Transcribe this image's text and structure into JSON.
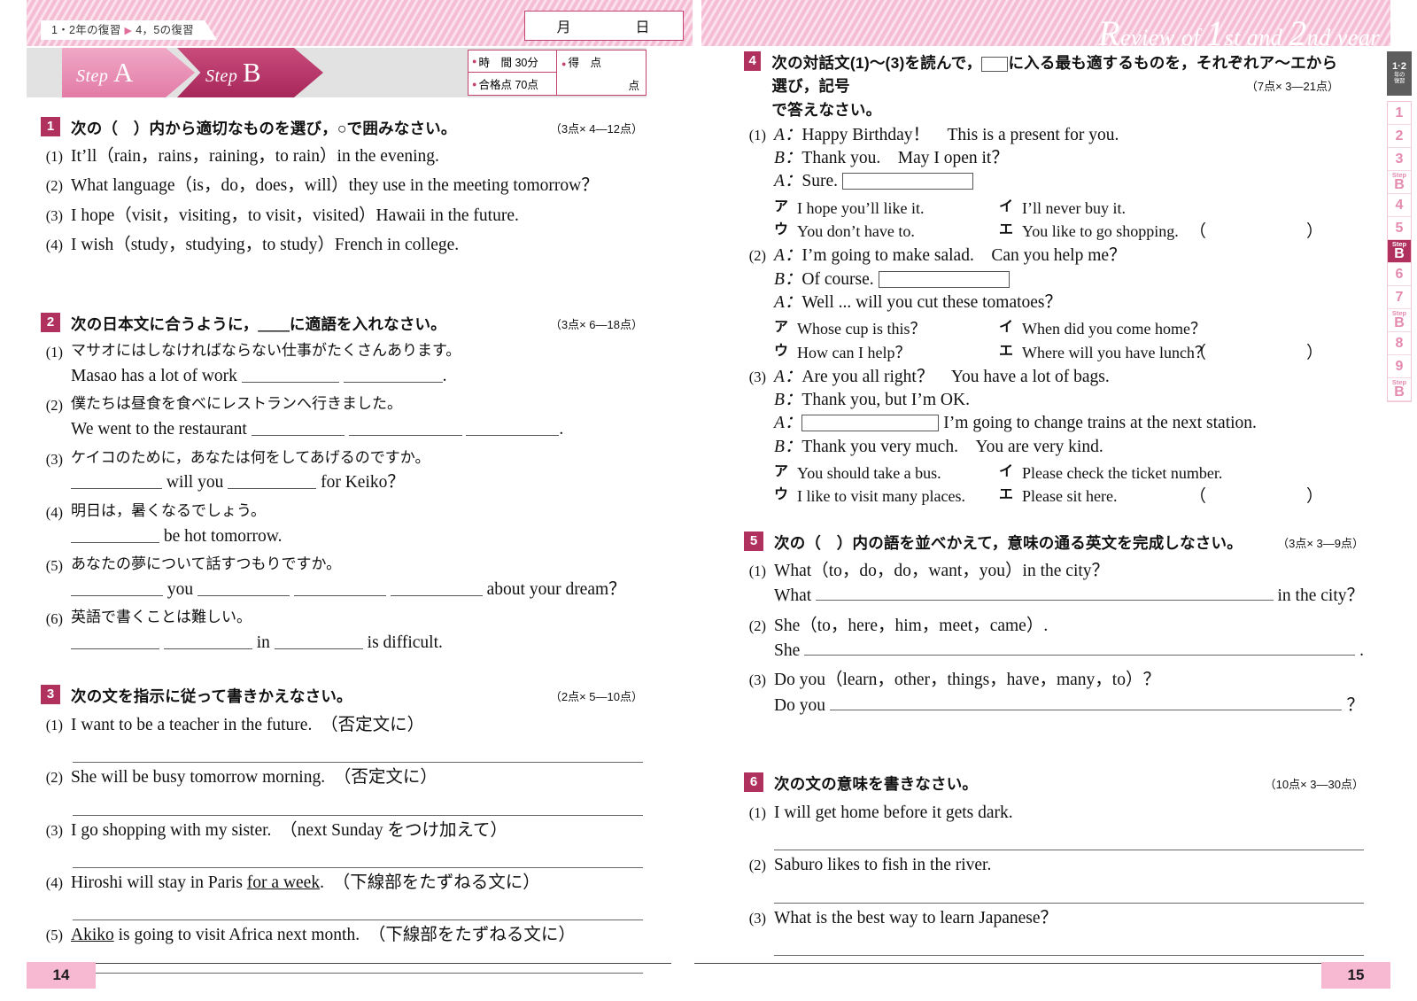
{
  "left_page": {
    "breadcrumb": {
      "main": "1・2年の復習",
      "sep": "▶",
      "sub": "4，5の復習"
    },
    "date_box": {
      "month": "月",
      "day": "日"
    },
    "steps": {
      "step_a": "Step",
      "step_a_letter": "A",
      "step_b": "Step",
      "step_b_letter": "B"
    },
    "score_box": {
      "time_label": "時　間",
      "time_value": "30分",
      "pass_label": "合格点",
      "pass_value": "70点",
      "score_label": "得　点",
      "score_unit": "点"
    },
    "page_number": "14",
    "q1": {
      "num": "1",
      "title": "次の（　）内から適切なものを選び，○で囲みなさい。",
      "points": "（3点× 4—12点）",
      "items": [
        {
          "n": "(1)",
          "text": "It’ll（rain，rains，raining，to rain）in the evening."
        },
        {
          "n": "(2)",
          "text": "What language（is，do，does，will）they use in the meeting tomorrow？"
        },
        {
          "n": "(3)",
          "text": "I hope（visit，visiting，to visit，visited）Hawaii in the future."
        },
        {
          "n": "(4)",
          "text": "I wish（study，studying，to study）French in college."
        }
      ]
    },
    "q2": {
      "num": "2",
      "title": "次の日本文に合うように，＿＿に適語を入れなさい。",
      "points": "（3点× 6—18点）",
      "items": [
        {
          "n": "(1)",
          "jp": "マサオにはしなければならない仕事がたくさんあります。",
          "en_pre": "Masao has a lot of work",
          "blanks": [
            110,
            112
          ],
          "en_post": "."
        },
        {
          "n": "(2)",
          "jp": "僕たちは昼食を食べにレストランへ行きました。",
          "en_pre": "We went to the restaurant",
          "blanks": [
            105,
            128,
            105
          ],
          "en_post": "."
        },
        {
          "n": "(3)",
          "jp": "ケイコのために，あなたは何をしてあげるのですか。",
          "en_pre": "",
          "blanks": [
            103
          ],
          "en_mid": "will you",
          "blanks2": [
            100
          ],
          "en_post": "for Keiko？"
        },
        {
          "n": "(4)",
          "jp": "明日は，暑くなるでしょう。",
          "en_pre": "",
          "blanks": [
            100
          ],
          "en_post": "be hot tomorrow."
        },
        {
          "n": "(5)",
          "jp": "あなたの夢について話すつもりですか。",
          "en_pre": "",
          "blanks": [
            104
          ],
          "en_mid": "you",
          "blanks2": [
            104,
            104,
            104
          ],
          "en_post": "about your dream？"
        },
        {
          "n": "(6)",
          "jp": "英語で書くことは難しい。",
          "en_pre": "",
          "blanks": [
            100,
            100
          ],
          "en_mid": "in",
          "blanks2": [
            100
          ],
          "en_post": "is difficult."
        }
      ]
    },
    "q3": {
      "num": "3",
      "title": "次の文を指示に従って書きかえなさい。",
      "points": "（2点× 5—10点）",
      "items": [
        {
          "n": "(1)",
          "text": "I want to be a teacher in the future.　（否定文に）"
        },
        {
          "n": "(2)",
          "text": "She will be busy tomorrow morning.　（否定文に）"
        },
        {
          "n": "(3)",
          "text": "I go shopping with my sister.　（next Sunday をつけ加えて）"
        },
        {
          "n": "(4)",
          "pre": "Hiroshi will stay in Paris ",
          "ul": "for a week",
          "post": ".　（下線部をたずねる文に）"
        },
        {
          "n": "(5)",
          "pre": "",
          "ul": "Akiko",
          "post": " is going to visit Africa next month.　（下線部をたずねる文に）"
        }
      ]
    }
  },
  "right_page": {
    "review_title_r": "R",
    "review_title_1": "eview of ",
    "review_title_big1": "1",
    "review_title_2": "st and ",
    "review_title_big2": "2",
    "review_title_3": "nd year",
    "page_number": "15",
    "tabs": {
      "top_main": "1·2",
      "top_sub1": "年の",
      "top_sub2": "復習",
      "items": [
        {
          "label": "1",
          "type": "num",
          "active": false
        },
        {
          "label": "2",
          "type": "num",
          "active": false
        },
        {
          "label": "3",
          "type": "num",
          "active": false
        },
        {
          "label": "Step",
          "sub": "B",
          "type": "step",
          "active": false
        },
        {
          "label": "4",
          "type": "num",
          "active": false
        },
        {
          "label": "5",
          "type": "num",
          "active": false
        },
        {
          "label": "Step",
          "sub": "B",
          "type": "step",
          "active": true
        },
        {
          "label": "6",
          "type": "num",
          "active": false
        },
        {
          "label": "7",
          "type": "num",
          "active": false
        },
        {
          "label": "Step",
          "sub": "B",
          "type": "step",
          "active": false
        },
        {
          "label": "8",
          "type": "num",
          "active": false
        },
        {
          "label": "9",
          "type": "num",
          "active": false
        },
        {
          "label": "Step",
          "sub": "B",
          "type": "step",
          "active": false
        }
      ]
    },
    "q4": {
      "num": "4",
      "title_a": "次の対話文(1)～(3)を読んで，",
      "title_b": "に入る最も適するものを，それぞれア～エから選び，記号",
      "title_c": "で答えなさい。",
      "points": "（7点× 3—21点）",
      "dialogs": [
        {
          "n": "(1)",
          "lines": [
            {
              "sp": "A：",
              "text": "Happy Birthday！　This is a present for you."
            },
            {
              "sp": "B：",
              "text": "Thank you.　May I open it？"
            },
            {
              "sp": "A：",
              "text": "Sure.",
              "box_after": 148
            }
          ],
          "choices": [
            {
              "key": "ア",
              "text": "I hope you’ll like it."
            },
            {
              "key": "イ",
              "text": "I’ll never buy it."
            },
            {
              "key": "ウ",
              "text": "You don’t have to."
            },
            {
              "key": "エ",
              "text": "You like to go shopping."
            }
          ],
          "answer_paren": "（　　　）"
        },
        {
          "n": "(2)",
          "lines": [
            {
              "sp": "A：",
              "text": "I’m going to make salad.　Can you help me？"
            },
            {
              "sp": "B：",
              "text": "Of course.",
              "box_after": 148
            },
            {
              "sp": "A：",
              "text": "Well ... will you cut these tomatoes？"
            }
          ],
          "choices": [
            {
              "key": "ア",
              "text": "Whose cup is this？"
            },
            {
              "key": "イ",
              "text": "When did you come home？"
            },
            {
              "key": "ウ",
              "text": "How can I help？"
            },
            {
              "key": "エ",
              "text": "Where will you have lunch？"
            }
          ],
          "answer_paren": "（　　　）"
        },
        {
          "n": "(3)",
          "lines": [
            {
              "sp": "A：",
              "text": "Are you all right？　You have a lot of bags."
            },
            {
              "sp": "B：",
              "text": "Thank you, but I’m OK."
            },
            {
              "sp": "A：",
              "text": "",
              "box_before": 155,
              "text_after": "I’m going to change trains at the next station."
            },
            {
              "sp": "B：",
              "text": "Thank you very much.　You are very kind."
            }
          ],
          "choices": [
            {
              "key": "ア",
              "text": "You should take a bus."
            },
            {
              "key": "イ",
              "text": "Please check the ticket number."
            },
            {
              "key": "ウ",
              "text": "I like to visit many places."
            },
            {
              "key": "エ",
              "text": "Please sit here."
            }
          ],
          "answer_paren": "（　　　）"
        }
      ]
    },
    "q5": {
      "num": "5",
      "title": "次の（　）内の語を並べかえて，意味の通る英文を完成しなさい。",
      "points": "（3点× 3—9点）",
      "items": [
        {
          "n": "(1)",
          "prompt": "What（to，do，do，want，you）in the city？",
          "lead": "What",
          "tail": "in the city？"
        },
        {
          "n": "(2)",
          "prompt": "She（to，here，him，meet，came）.",
          "lead": "She",
          "tail": "."
        },
        {
          "n": "(3)",
          "prompt": "Do you（learn，other，things，have，many，to）？",
          "lead": "Do you",
          "tail": "？"
        }
      ]
    },
    "q6": {
      "num": "6",
      "title": "次の文の意味を書きなさい。",
      "points": "（10点× 3—30点）",
      "items": [
        {
          "n": "(1)",
          "text": "I will get home before it gets dark."
        },
        {
          "n": "(2)",
          "text": "Saburo likes to fish in the river."
        },
        {
          "n": "(3)",
          "text": "What is the best way to learn Japanese？"
        }
      ]
    }
  }
}
